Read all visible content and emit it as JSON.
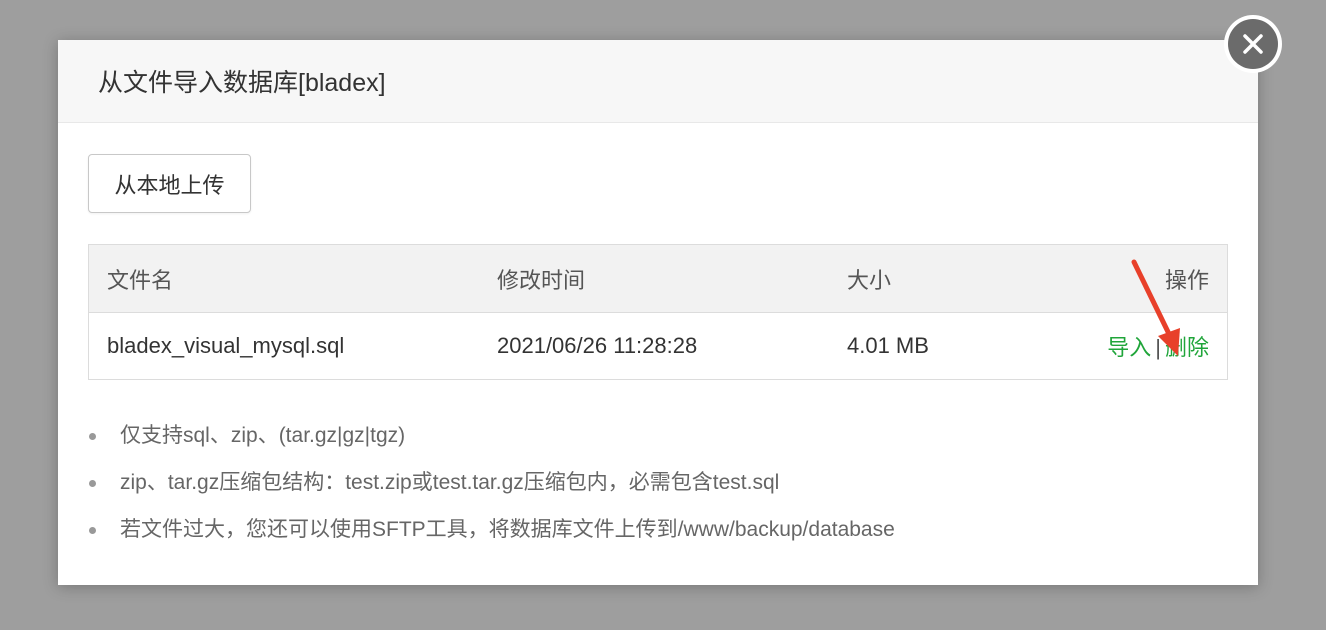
{
  "dialog": {
    "title": "从文件导入数据库[bladex]",
    "close_icon": "close-icon"
  },
  "toolbar": {
    "upload_label": "从本地上传"
  },
  "table": {
    "headers": {
      "name": "文件名",
      "time": "修改时间",
      "size": "大小",
      "ops": "操作"
    },
    "rows": [
      {
        "name": "bladex_visual_mysql.sql",
        "time": "2021/06/26 11:28:28",
        "size": "4.01 MB",
        "import_label": "导入",
        "separator": "|",
        "delete_label": "删除"
      }
    ]
  },
  "notes": [
    "仅支持sql、zip、(tar.gz|gz|tgz)",
    "zip、tar.gz压缩包结构：test.zip或test.tar.gz压缩包内，必需包含test.sql",
    "若文件过大，您还可以使用SFTP工具，将数据库文件上传到/www/backup/database"
  ],
  "colors": {
    "accent_green": "#20a53a",
    "arrow_red": "#e8402a",
    "overlay": "#9e9e9e"
  }
}
